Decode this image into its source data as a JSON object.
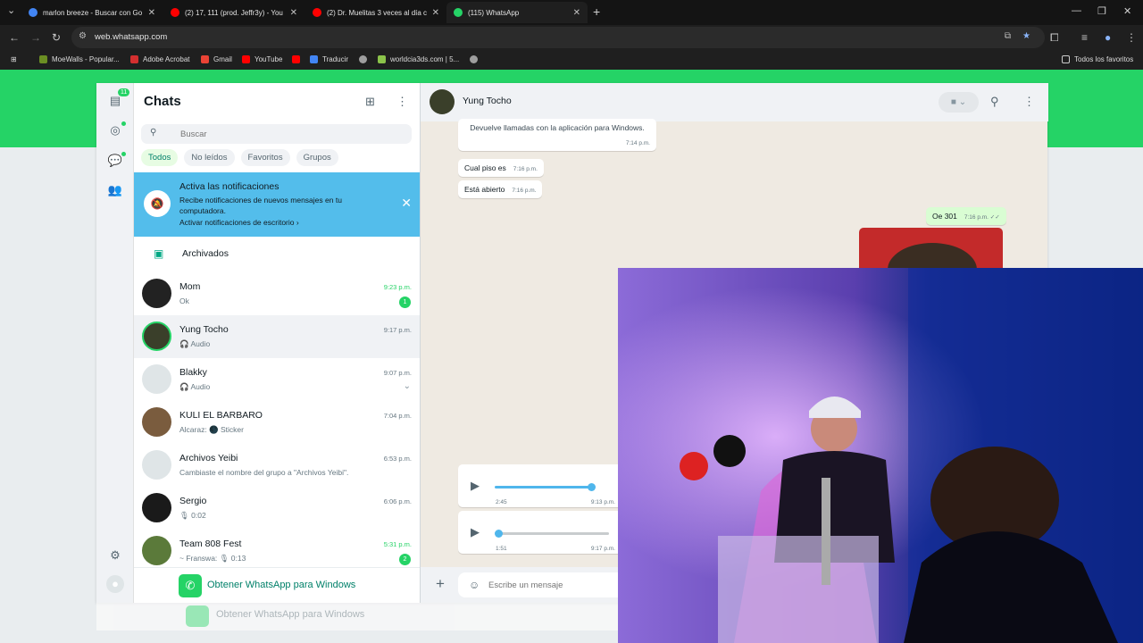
{
  "browser": {
    "tabs": [
      {
        "title": "marlon breeze - Buscar con Go",
        "favicon": "#4285f4",
        "active": false
      },
      {
        "title": "(2) 17, 111 (prod. Jeffr3y) - You",
        "favicon": "#ff0000",
        "active": false
      },
      {
        "title": "(2) Dr. Muelitas 3 veces al día c",
        "favicon": "#ff0000",
        "active": false
      },
      {
        "title": "(115) WhatsApp",
        "favicon": "#25d366",
        "active": true
      }
    ],
    "url": "web.whatsapp.com",
    "bookmarks": [
      {
        "label": "MoeWalls - Popular...",
        "color": "#6b8e23"
      },
      {
        "label": "Adobe Acrobat",
        "color": "#d32f2f"
      },
      {
        "label": "Gmail",
        "color": "#ea4335"
      },
      {
        "label": "YouTube",
        "color": "#ff0000"
      },
      {
        "label": "",
        "color": "#ff0000"
      },
      {
        "label": "Traducir",
        "color": "#4285f4"
      },
      {
        "label": "",
        "color": "#9e9e9e"
      },
      {
        "label": "worldcia3ds.com | 5...",
        "color": "#8bc34a"
      },
      {
        "label": "",
        "color": "#9e9e9e"
      }
    ],
    "all_bookmarks": "Todos los favoritos"
  },
  "rail": {
    "chats_badge": "11"
  },
  "sidebar": {
    "title": "Chats",
    "search_placeholder": "Buscar",
    "filters": [
      "Todos",
      "No leídos",
      "Favoritos",
      "Grupos"
    ],
    "notification": {
      "title": "Activa las notificaciones",
      "body": "Recibe notificaciones de nuevos mensajes en tu computadora.",
      "link": "Activar notificaciones de escritorio ›"
    },
    "archived": "Archivados",
    "chats": [
      {
        "name": "Mom",
        "preview": "Ok",
        "time": "9:23 p.m.",
        "unread": "1",
        "avatar": "#222222"
      },
      {
        "name": "Yung Tocho",
        "preview": "🎧 Audio",
        "time": "9:17 p.m.",
        "unread": "",
        "avatar": "#3a3f2a"
      },
      {
        "name": "Blakky",
        "preview": "🎧 Audio",
        "time": "9:07 p.m.",
        "unread": "",
        "avatar": "#dfe5e7"
      },
      {
        "name": "KULI EL BARBARO",
        "preview": "Alcaraz: 🌑 Sticker",
        "time": "7:04 p.m.",
        "unread": "",
        "avatar": "#7a5c3e"
      },
      {
        "name": "Archivos Yeibi",
        "preview": "Cambiaste el nombre del grupo a \"Archivos Yeibi\".",
        "time": "6:53 p.m.",
        "unread": "",
        "avatar": "#dfe5e7"
      },
      {
        "name": "Sergio",
        "preview": "🎙 0:02",
        "time": "6:06 p.m.",
        "unread": "",
        "avatar": "#1a1a1a"
      },
      {
        "name": "Team 808 Fest",
        "preview": "~ Franswa: 🎙 0:13",
        "time": "5:31 p.m.",
        "unread": "2",
        "avatar": "#5b7a3a"
      }
    ],
    "get_app": "Obtener WhatsApp para Windows"
  },
  "conversation": {
    "contact": "Yung Tocho",
    "messages": [
      {
        "text": "Devuelve llamadas con la aplicación para Windows.",
        "time": "7:14 p.m."
      },
      {
        "text": "Cual piso es",
        "time": "7:16 p.m."
      },
      {
        "text": "Está abierto",
        "time": "7:16 p.m."
      },
      {
        "text": "Oe 301",
        "time": "7:16 p.m. ✓✓"
      }
    ],
    "audios": [
      {
        "duration": "2:45",
        "time": "9:13 p.m.",
        "progress": 1.0
      },
      {
        "duration": "1:51",
        "time": "9:17 p.m.",
        "progress": 0.0
      }
    ],
    "composer_placeholder": "Escribe un mensaje"
  }
}
